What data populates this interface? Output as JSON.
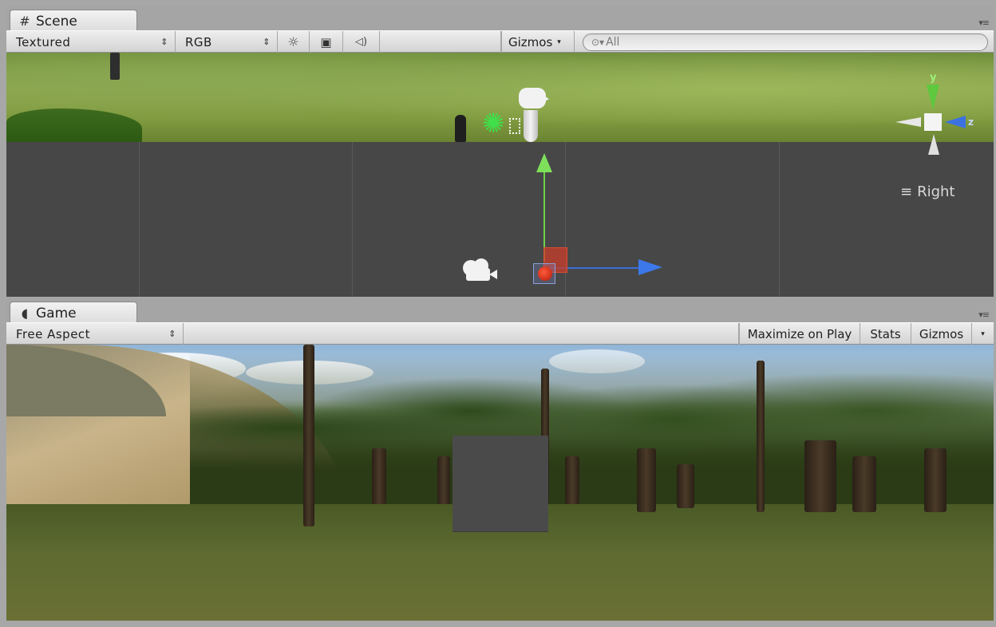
{
  "scene_panel": {
    "tab_label": "Scene",
    "tab_icon": "grid-hash-icon",
    "toolbar": {
      "render_mode": "Textured",
      "color_mode": "RGB",
      "lighting_icon": "sun-icon",
      "image_icon": "image-icon",
      "audio_icon": "speaker-icon",
      "gizmos_label": "Gizmos",
      "search_placeholder": "All"
    },
    "view_label": "Right",
    "gizmo_axes": {
      "y": "y",
      "z": "z"
    },
    "colors": {
      "y_axis": "#6dd24a",
      "z_axis": "#3c78ea",
      "center": "#e04a30",
      "grid_bg": "#474747"
    }
  },
  "game_panel": {
    "tab_label": "Game",
    "tab_icon": "pacman-game-icon",
    "toolbar": {
      "aspect": "Free Aspect",
      "maximize_on_play": "Maximize on Play",
      "stats": "Stats",
      "gizmos": "Gizmos"
    }
  },
  "glyphs": {
    "hash": "#",
    "game": "◖",
    "sun": "☼",
    "image": "▣",
    "speaker": "◁)",
    "menu": "▾≡",
    "mag": "⊙▾",
    "camera": "🎥",
    "light": "✺",
    "list": "≡",
    "dropdown": "▾"
  }
}
